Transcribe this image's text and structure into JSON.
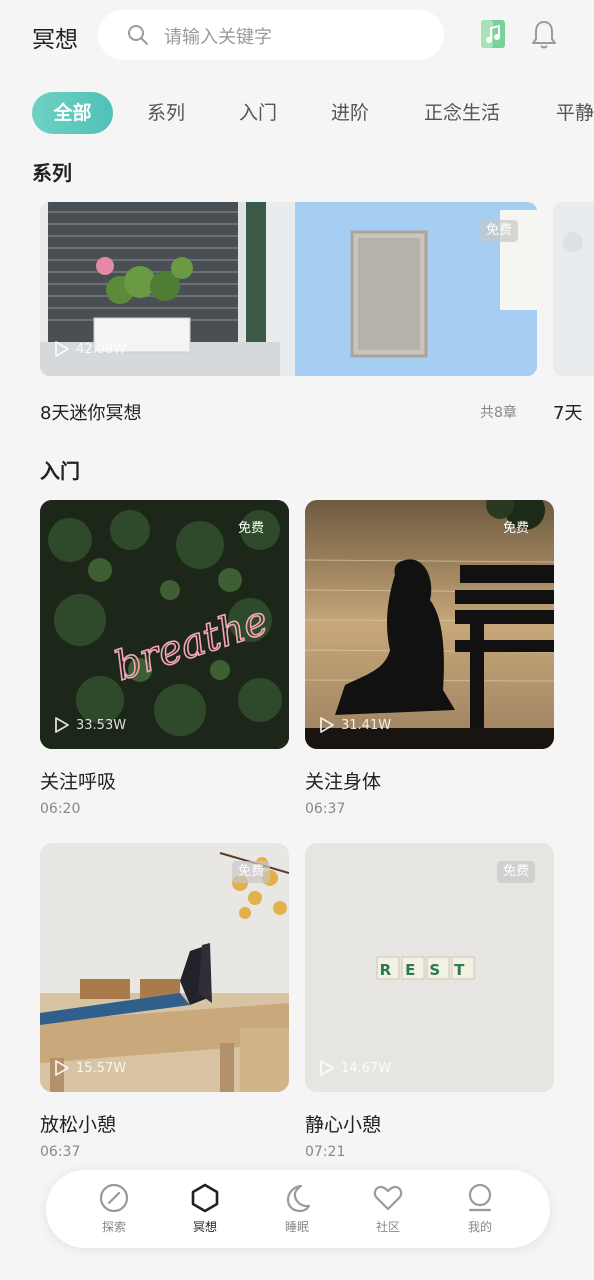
{
  "header": {
    "title": "冥想",
    "search_placeholder": "请输入关键字",
    "music_icon": "music-note-icon",
    "bell_icon": "bell-icon"
  },
  "tabs": [
    {
      "label": "全部",
      "active": true
    },
    {
      "label": "系列",
      "active": false
    },
    {
      "label": "入门",
      "active": false
    },
    {
      "label": "进阶",
      "active": false
    },
    {
      "label": "正念生活",
      "active": false
    },
    {
      "label": "平静",
      "active": false
    }
  ],
  "series": {
    "section_title": "系列",
    "items": [
      {
        "name": "8天迷你冥想",
        "count": "共8章",
        "badge": "免费",
        "plays": "42.08W"
      },
      {
        "name": "7天"
      }
    ]
  },
  "intro": {
    "section_title": "入门",
    "cards": [
      {
        "title": "关注呼吸",
        "duration": "06:20",
        "badge": "免费",
        "plays": "33.53W",
        "image_text": "breathe"
      },
      {
        "title": "关注身体",
        "duration": "06:37",
        "badge": "免费",
        "plays": "31.41W"
      },
      {
        "title": "放松小憩",
        "duration": "06:37",
        "badge": "免费",
        "plays": "15.57W"
      },
      {
        "title": "静心小憩",
        "duration": "07:21",
        "badge": "免费",
        "plays": "14.67W",
        "image_text": "REST"
      }
    ]
  },
  "bottom_nav": [
    {
      "label": "探索",
      "icon": "compass-icon",
      "active": false
    },
    {
      "label": "冥想",
      "icon": "hexagon-icon",
      "active": true
    },
    {
      "label": "睡眠",
      "icon": "moon-icon",
      "active": false
    },
    {
      "label": "社区",
      "icon": "heart-icon",
      "active": false
    },
    {
      "label": "我的",
      "icon": "profile-icon",
      "active": false
    }
  ],
  "colors": {
    "accent": "#4fc1b8",
    "background": "#f5f5f6"
  }
}
